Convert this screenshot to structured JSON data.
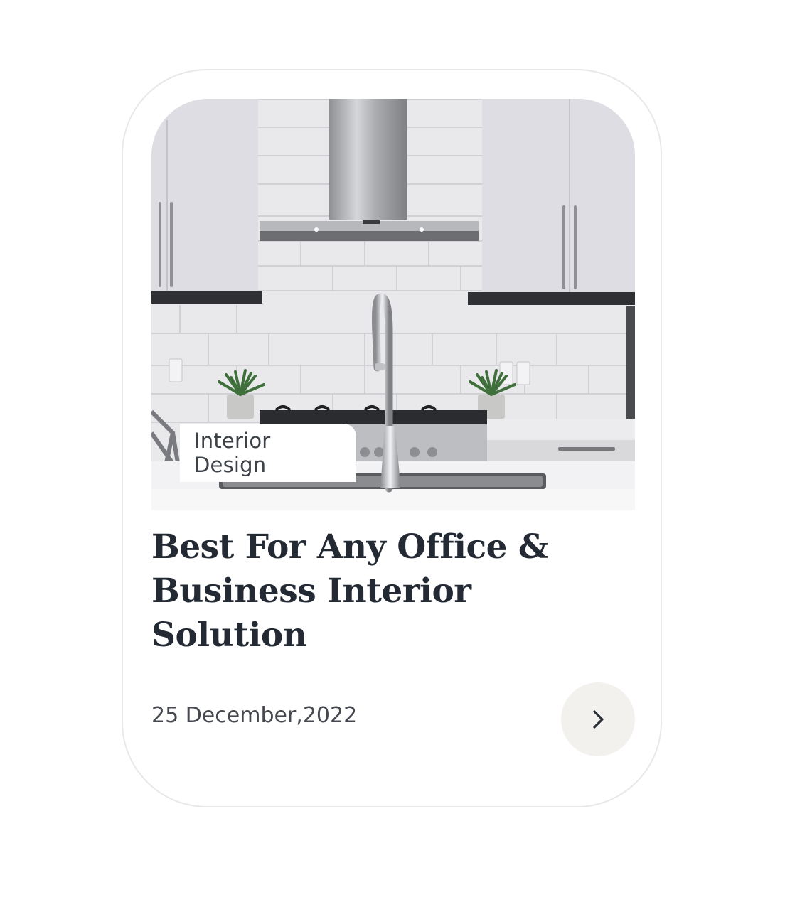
{
  "card": {
    "category_tag": "Interior Design",
    "title": "Best For Any Office & Business Interior Solution",
    "date": "25 December,2022",
    "image_alt": "kitchen-photo",
    "arrow_icon": "chevron-right-icon",
    "colors": {
      "title": "#232a33",
      "text": "#45494f",
      "button_bg": "#f3f1ed",
      "border": "#e8e8e8"
    }
  }
}
